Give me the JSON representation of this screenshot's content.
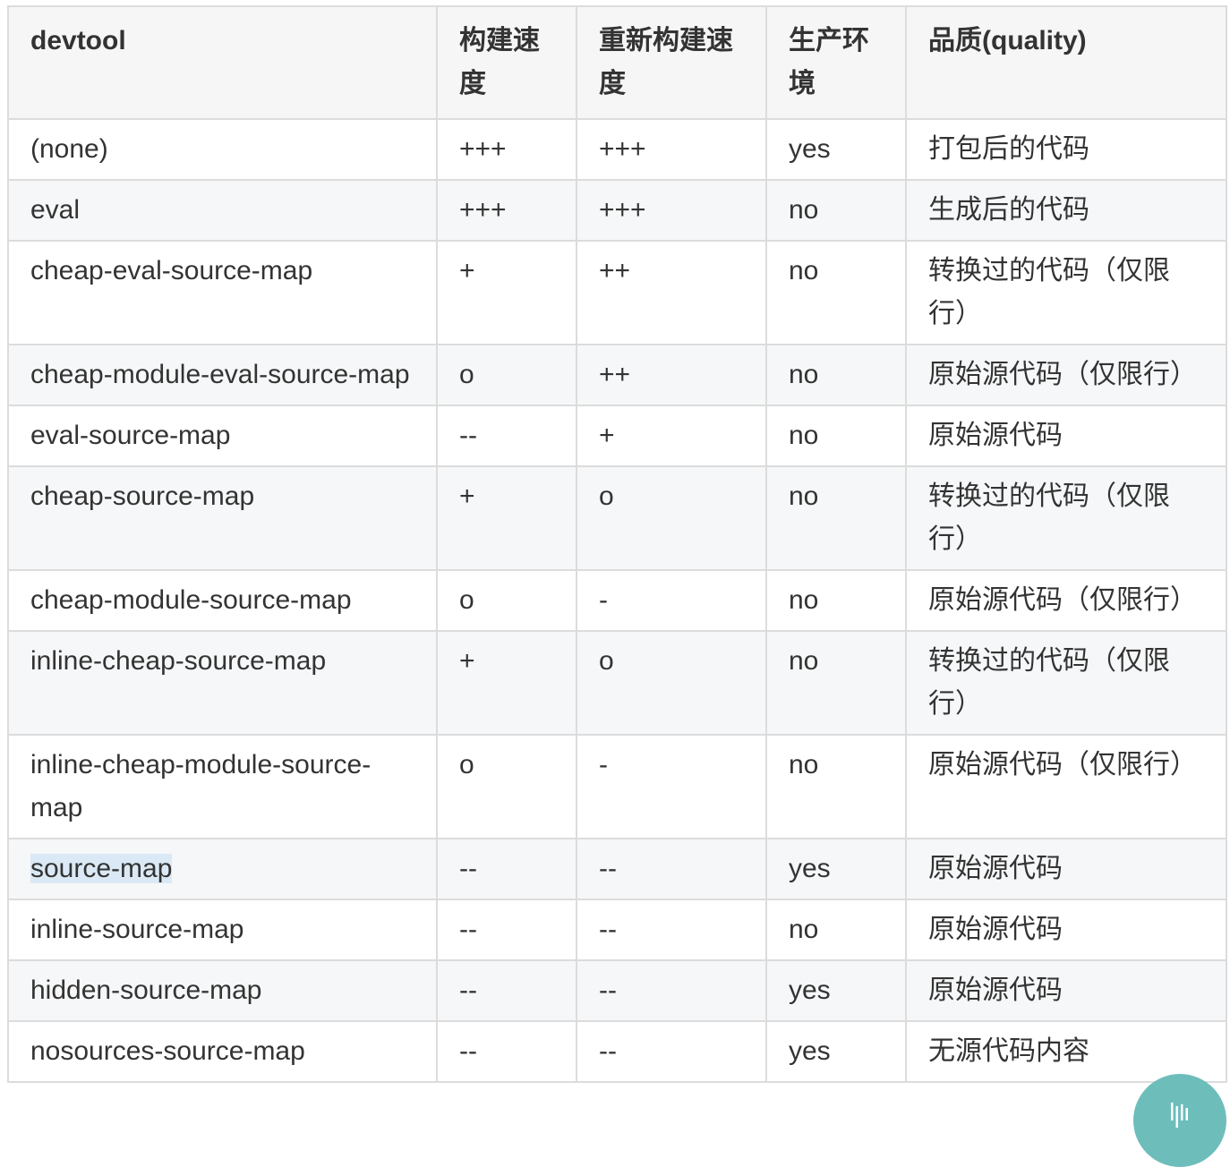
{
  "table": {
    "headers": [
      "devtool",
      "构建速度",
      "重新构建速度",
      "生产环境",
      "品质(quality)"
    ],
    "rows": [
      [
        "(none)",
        "+++",
        "+++",
        "yes",
        "打包后的代码"
      ],
      [
        "eval",
        "+++",
        "+++",
        "no",
        "生成后的代码"
      ],
      [
        "cheap-eval-source-map",
        "+",
        "++",
        "no",
        "转换过的代码（仅限行）"
      ],
      [
        "cheap-module-eval-source-map",
        "o",
        "++",
        "no",
        "原始源代码（仅限行）"
      ],
      [
        "eval-source-map",
        "--",
        "+",
        "no",
        "原始源代码"
      ],
      [
        "cheap-source-map",
        "+",
        "o",
        "no",
        "转换过的代码（仅限行）"
      ],
      [
        "cheap-module-source-map",
        "o",
        "-",
        "no",
        "原始源代码（仅限行）"
      ],
      [
        "inline-cheap-source-map",
        "+",
        "o",
        "no",
        "转换过的代码（仅限行）"
      ],
      [
        "inline-cheap-module-source-map",
        "o",
        "-",
        "no",
        "原始源代码（仅限行）"
      ],
      [
        "source-map",
        "--",
        "--",
        "yes",
        "原始源代码"
      ],
      [
        "inline-source-map",
        "--",
        "--",
        "no",
        "原始源代码"
      ],
      [
        "hidden-source-map",
        "--",
        "--",
        "yes",
        "原始源代码"
      ],
      [
        "nosources-source-map",
        "--",
        "--",
        "yes",
        "无源代码内容"
      ]
    ]
  },
  "selection": {
    "text": "source-map"
  },
  "floating_button": {
    "icon": "waveform-icon",
    "color": "#6dbdbb"
  }
}
